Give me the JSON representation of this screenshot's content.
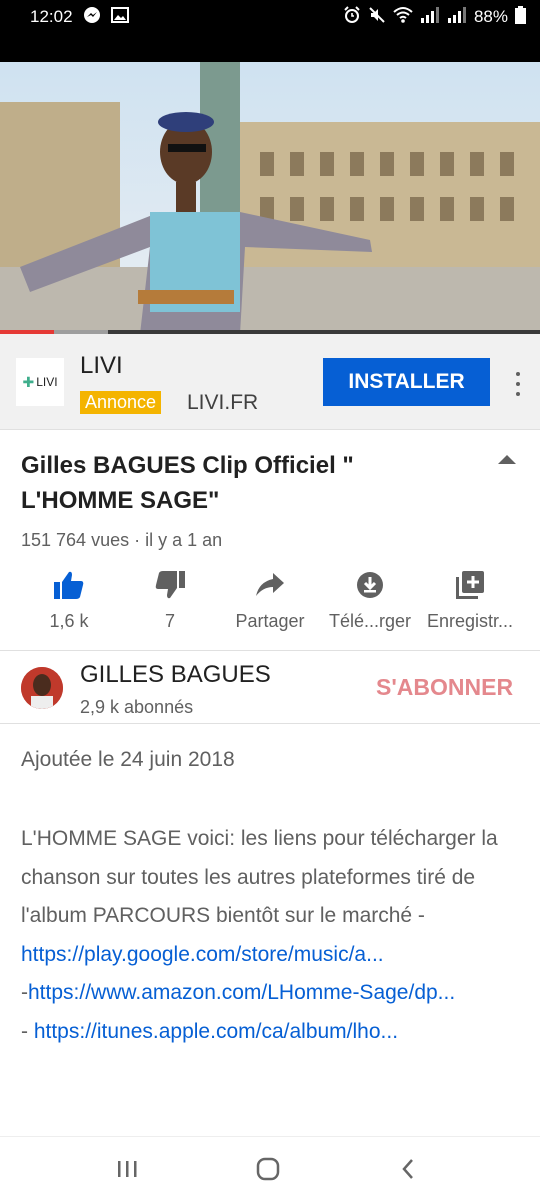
{
  "status_bar": {
    "time": "12:02",
    "battery": "88%"
  },
  "video": {
    "progress_fraction": 0.1,
    "buffer_fraction": 0.1
  },
  "ad": {
    "logo_text": "LIVI",
    "title": "LIVI",
    "badge": "Annonce",
    "domain": "LIVI.FR",
    "install_label": "INSTALLER",
    "accent_color": "#065fd4",
    "badge_color": "#f4b400"
  },
  "video_info": {
    "title": "Gilles BAGUES Clip Officiel \"\nL'HOMME SAGE\"",
    "meta": "151 764 vues · il y a 1 an"
  },
  "actions": {
    "like_count": "1,6 k",
    "dislike_count": "7",
    "share_label": "Partager",
    "download_label": "Télé...rger",
    "save_label": "Enregistr..."
  },
  "channel": {
    "name": "GILLES BAGUES",
    "subscribers": "2,9 k abonnés",
    "subscribe_label": "S'ABONNER"
  },
  "description": {
    "date": "Ajoutée le 24 juin 2018",
    "text_1": "L'HOMME SAGE voici: les liens pour télécharger la chanson sur toutes les autres plateformes  tiré de l'album PARCOURS bientôt sur le marché -",
    "link_1": "https://play.google.com/store/music/a...",
    "link_2_prefix": "-",
    "link_2": "https://www.amazon.com/LHomme-Sage/dp...",
    "link_3_prefix": "- ",
    "link_3": "https://itunes.apple.com/ca/album/lho..."
  }
}
